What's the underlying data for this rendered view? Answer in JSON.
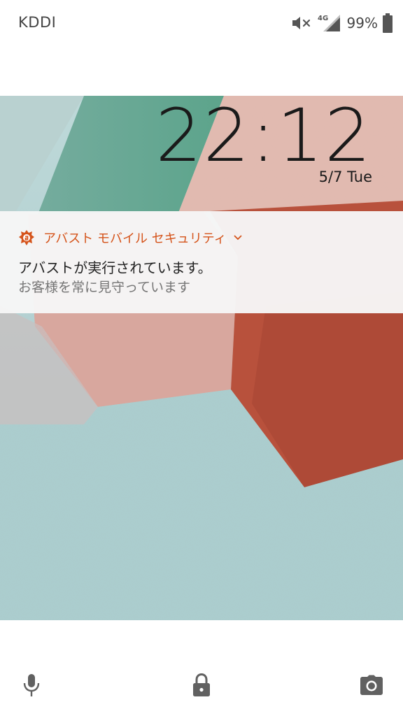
{
  "status_bar": {
    "carrier": "KDDI",
    "network": "4G",
    "battery": "99%",
    "icons": [
      "mute-icon",
      "signal-icon",
      "battery-icon"
    ]
  },
  "lock_screen": {
    "time": "22:12",
    "date": "5/7 Tue"
  },
  "notification": {
    "app_name": "アバスト モバイル セキュリティ",
    "title": "アバストが実行されています。",
    "text": "お客様を常に見守っています",
    "accent_color": "#d5541b"
  },
  "shortcuts": {
    "icons": [
      "microphone-icon",
      "lock-icon",
      "camera-icon"
    ]
  }
}
